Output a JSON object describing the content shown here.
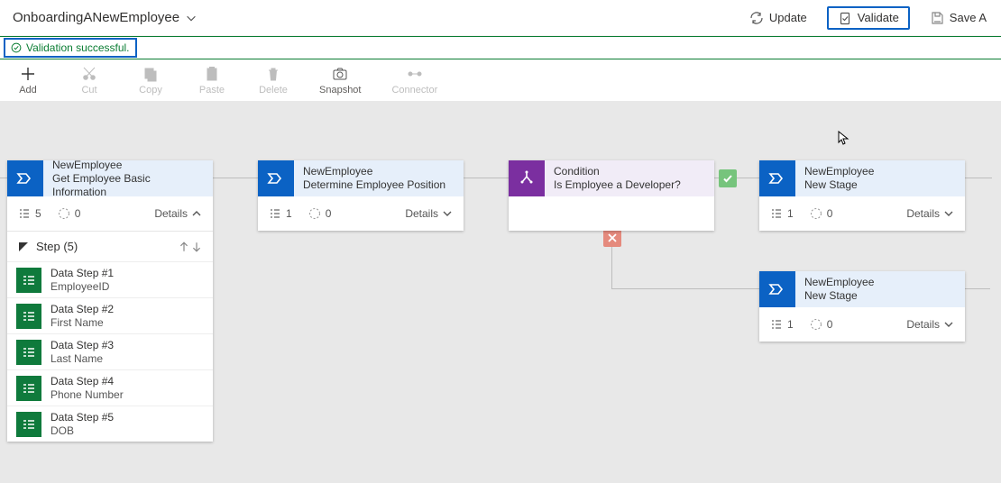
{
  "header": {
    "title": "OnboardingANewEmployee",
    "update": "Update",
    "validate": "Validate",
    "save": "Save A"
  },
  "validation": {
    "message": "Validation successful."
  },
  "toolbar": {
    "add": "Add",
    "cut": "Cut",
    "copy": "Copy",
    "paste": "Paste",
    "delete": "Delete",
    "snapshot": "Snapshot",
    "connector": "Connector"
  },
  "stages": {
    "s1": {
      "entity": "NewEmployee",
      "name": "Get Employee Basic Information",
      "stepsCount": "5",
      "dur": "0",
      "details": "Details",
      "stepHeader": "Step (5)",
      "steps": [
        {
          "title": "Data Step #1",
          "field": "EmployeeID"
        },
        {
          "title": "Data Step #2",
          "field": "First Name"
        },
        {
          "title": "Data Step #3",
          "field": "Last Name"
        },
        {
          "title": "Data Step #4",
          "field": "Phone Number"
        },
        {
          "title": "Data Step #5",
          "field": "DOB"
        }
      ]
    },
    "s2": {
      "entity": "NewEmployee",
      "name": "Determine Employee Position",
      "stepsCount": "1",
      "dur": "0",
      "details": "Details"
    },
    "s3": {
      "entity": "Condition",
      "name": "Is Employee a Developer?"
    },
    "s4": {
      "entity": "NewEmployee",
      "name": "New Stage",
      "stepsCount": "1",
      "dur": "0",
      "details": "Details"
    },
    "s5": {
      "entity": "NewEmployee",
      "name": "New Stage",
      "stepsCount": "1",
      "dur": "0",
      "details": "Details"
    }
  },
  "colors": {
    "blue": "#0b62c4",
    "green": "#0a7d33",
    "purple": "#7b2fa0",
    "stepGreen": "#0f7a3c",
    "okBadge": "#76c47c",
    "noBadge": "#e58a7d"
  }
}
